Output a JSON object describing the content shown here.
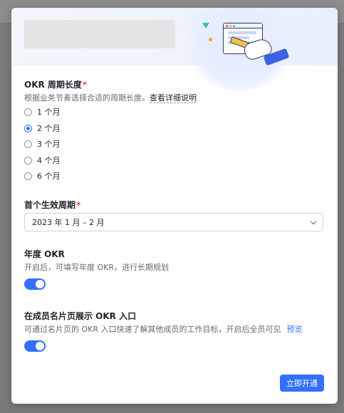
{
  "form": {
    "cycle_length": {
      "title": "OKR 周期长度",
      "required_mark": "*",
      "description": "根据业务节奏选择合适的周期长度。",
      "detail_link": "查看详细说明",
      "options": [
        {
          "label": "1 个月",
          "checked": false
        },
        {
          "label": "2 个月",
          "checked": true
        },
        {
          "label": "3 个月",
          "checked": false
        },
        {
          "label": "4 个月",
          "checked": false
        },
        {
          "label": "6 个月",
          "checked": false
        }
      ]
    },
    "first_cycle": {
      "title": "首个生效周期",
      "required_mark": "*",
      "selected_value": "2023 年 1 月 – 2 月"
    },
    "annual_okr": {
      "title": "年度 OKR",
      "description": "开启后，可填写年度 OKR，进行长期规划",
      "enabled": true
    },
    "profile_entry": {
      "title": "在成员名片页展示 OKR 入口",
      "description": "可通过名片页的 OKR 入口快速了解其他成员的工作目标，开启后全员可见",
      "preview_link": "预览",
      "enabled": true
    }
  },
  "footer": {
    "submit_label": "立即开通"
  },
  "colors": {
    "accent": "#3370ff",
    "required": "#f54a45",
    "text_primary": "#1f2329",
    "text_secondary": "#646a73"
  }
}
